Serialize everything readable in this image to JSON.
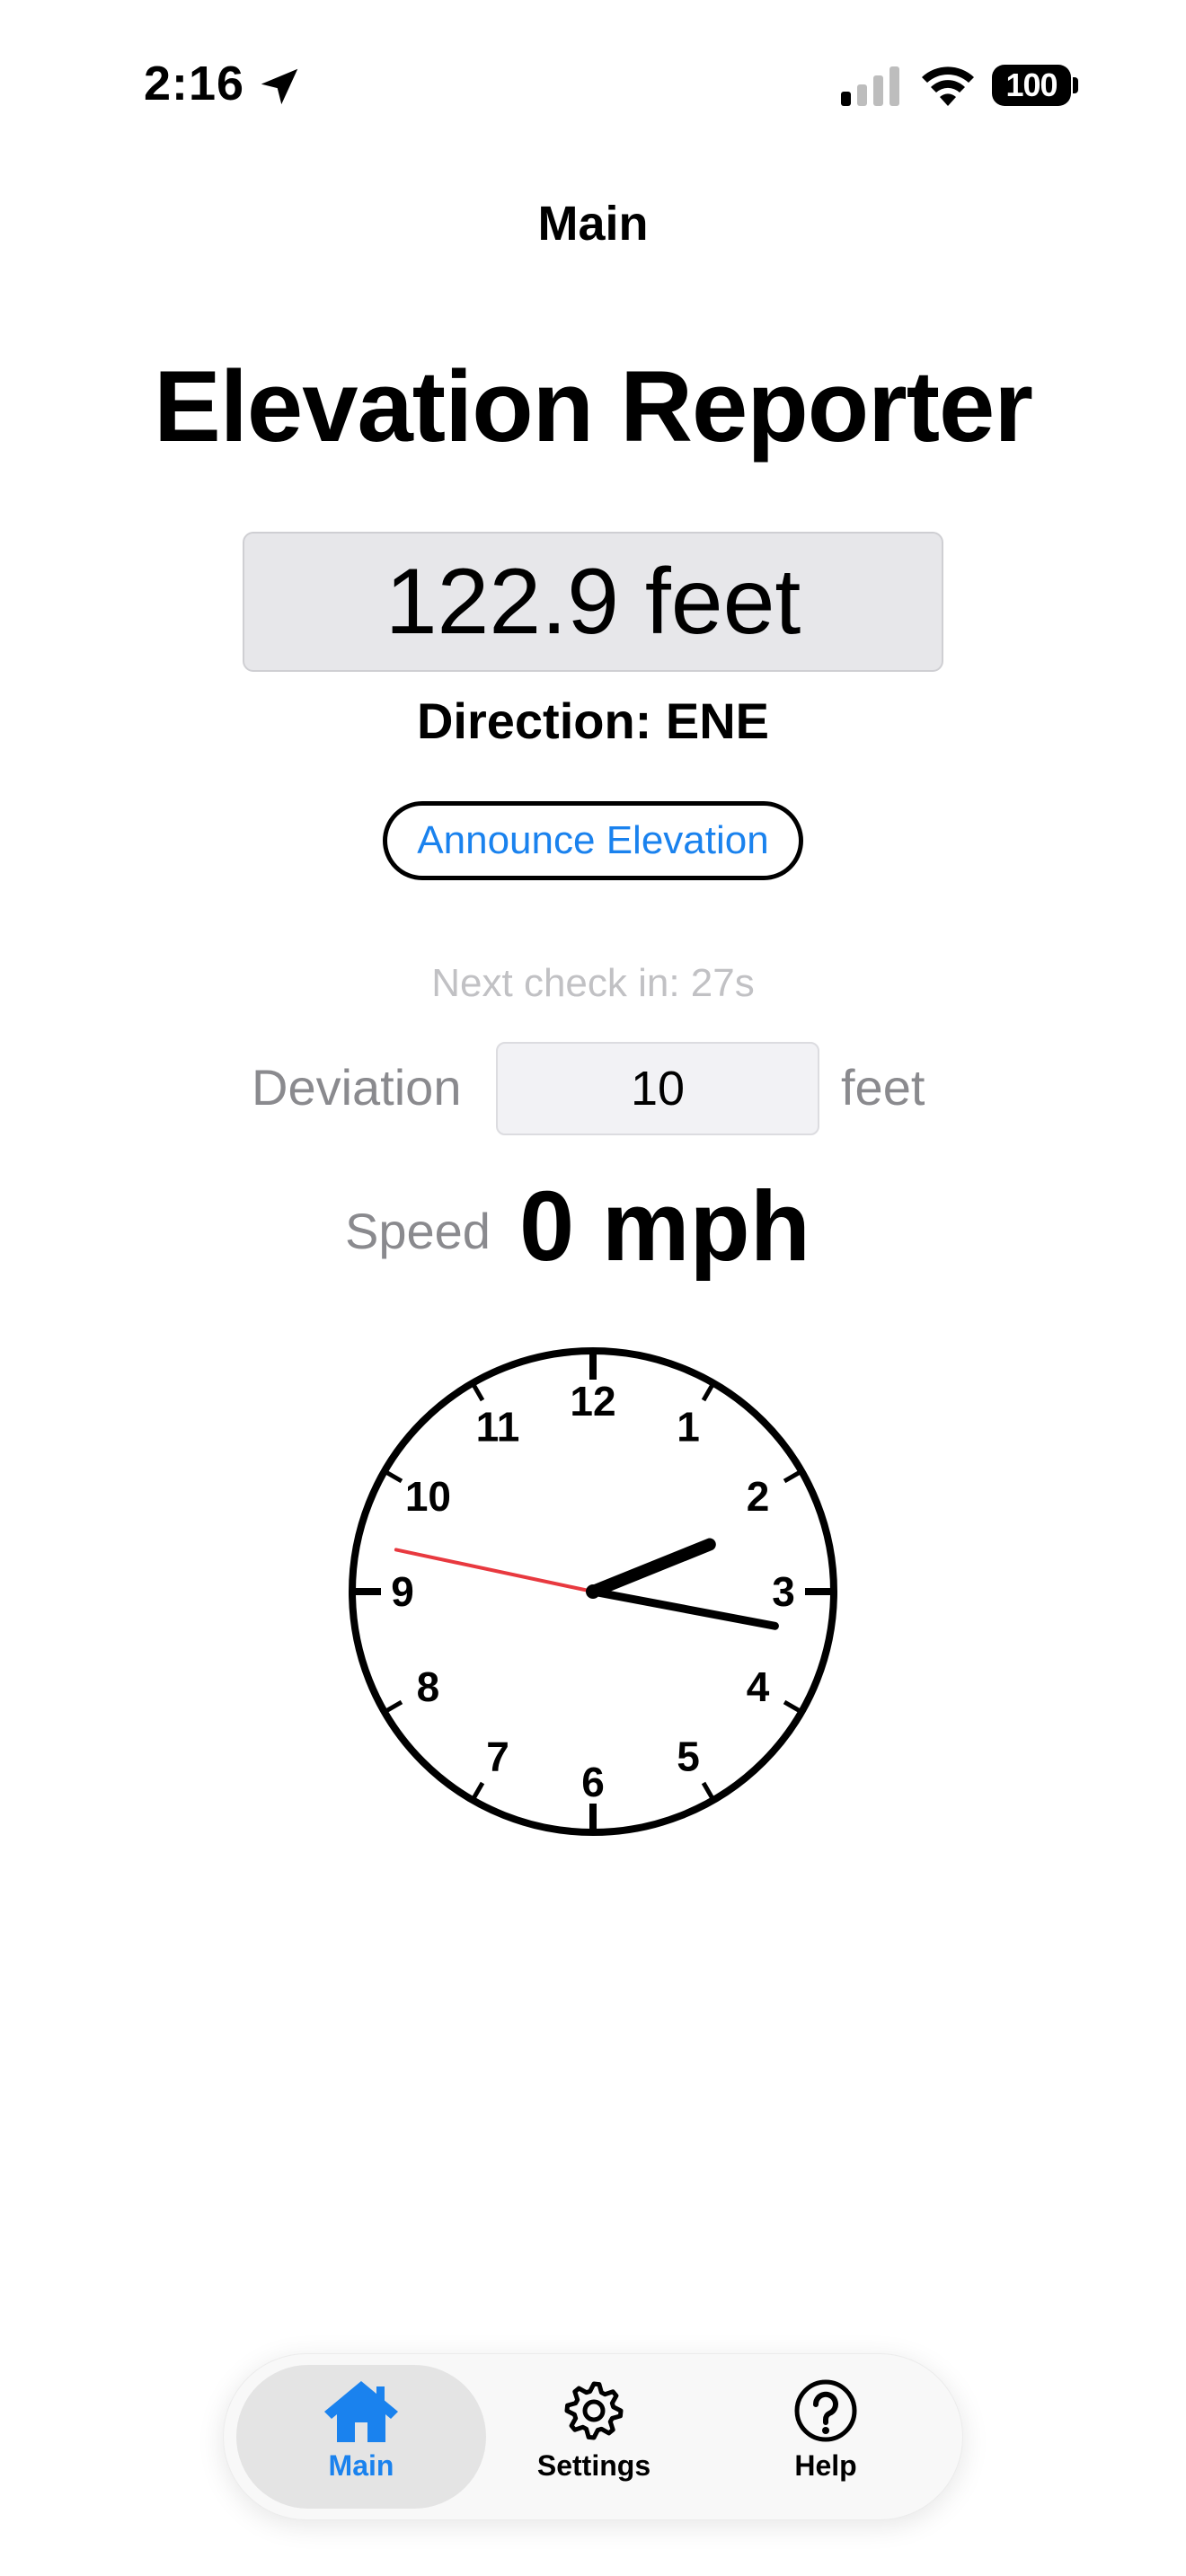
{
  "status_bar": {
    "time": "2:16",
    "battery": "100",
    "icons": [
      "location-arrow-icon",
      "signal-icon",
      "wifi-icon",
      "battery-icon"
    ]
  },
  "nav": {
    "title": "Main"
  },
  "app": {
    "title": "Elevation Reporter",
    "elevation": "122.9 feet",
    "direction": "Direction: ENE",
    "announce_label": "Announce Elevation",
    "next_check": "Next check in: 27s",
    "deviation_label": "Deviation",
    "deviation_value": "10",
    "deviation_unit": "feet",
    "speed_label": "Speed",
    "speed_value": "0 mph"
  },
  "clock": {
    "numbers": [
      "12",
      "1",
      "2",
      "3",
      "4",
      "5",
      "6",
      "7",
      "8",
      "9",
      "10",
      "11"
    ],
    "hour": 2,
    "minute": 16,
    "second": 47,
    "second_hand_color": "#e8393f"
  },
  "tabs": [
    {
      "label": "Main",
      "icon": "house-icon",
      "active": true
    },
    {
      "label": "Settings",
      "icon": "gear-icon",
      "active": false
    },
    {
      "label": "Help",
      "icon": "question-circle-icon",
      "active": false
    }
  ],
  "colors": {
    "accent": "#1a82ee",
    "field_bg": "#e7e7ea",
    "secondary_text": "#8a8a8e"
  }
}
